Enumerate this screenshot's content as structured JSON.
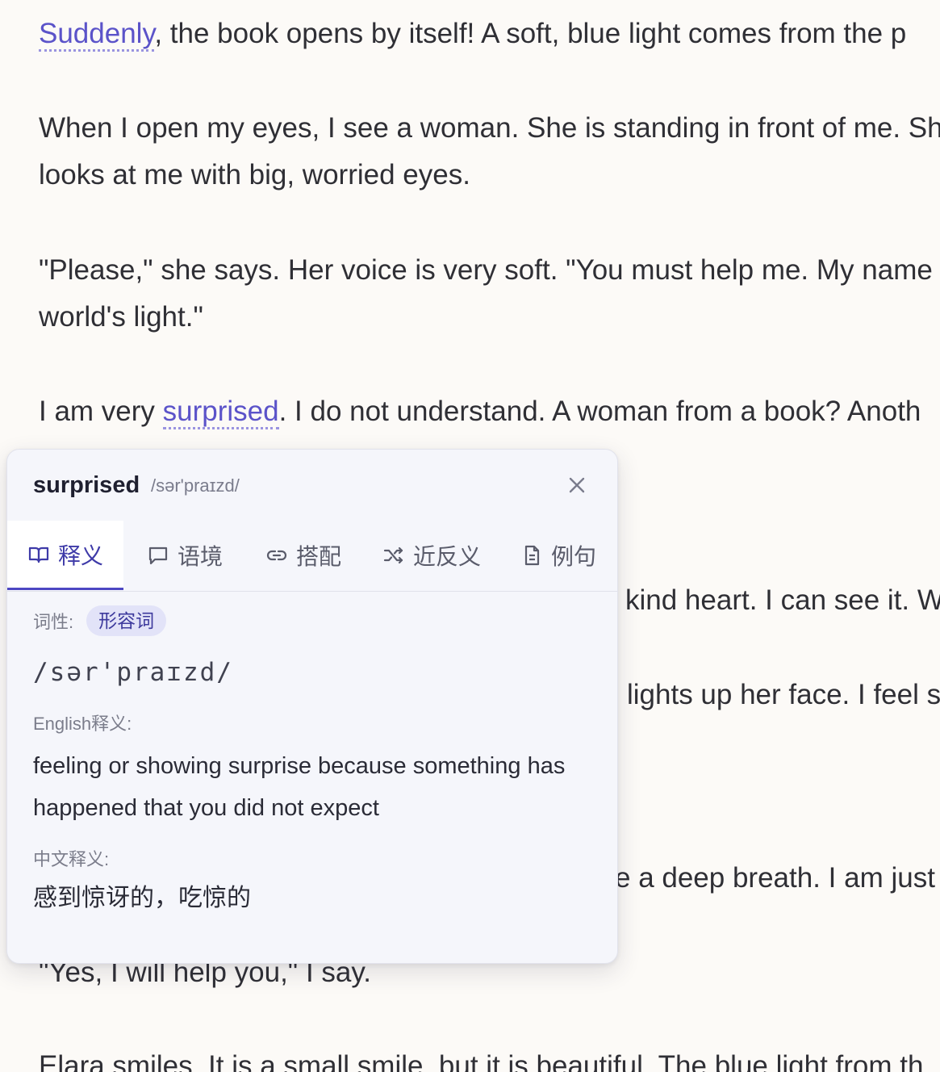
{
  "reader": {
    "p1": {
      "link": "Suddenly",
      "rest": ", the book opens by itself! A soft, blue light comes from the p"
    },
    "p2_line1": "When I open my eyes, I see a woman. She is standing in front of me. Sh",
    "p2_line2": "looks at me with big, worried eyes.",
    "p3_line1": "\"Please,\" she says. Her voice is very soft. \"You must help me. My name",
    "p3_line2": "world's light.\"",
    "p4": {
      "pre": "I am very ",
      "link": "surprised",
      "rest": ". I do not understand. A woman from a book? Anoth"
    },
    "frag1": "kind heart. I can see it. W",
    "frag2": "lights up her face. I feel s",
    "frag3": "e a deep breath. I am just",
    "p_yes": "\"Yes, I will help you,\" I say.",
    "p_last": "Elara smiles. It is a small smile, but it is beautiful. The blue light from th"
  },
  "popup": {
    "word": "surprised",
    "phonetic": "/sər'praɪzd/",
    "tabs": [
      {
        "label": "释义",
        "icon": "book-open-icon",
        "active": true
      },
      {
        "label": "语境",
        "icon": "chat-bubble-icon",
        "active": false
      },
      {
        "label": "搭配",
        "icon": "link-icon",
        "active": false
      },
      {
        "label": "近反义",
        "icon": "shuffle-icon",
        "active": false
      },
      {
        "label": "例句",
        "icon": "document-icon",
        "active": false
      }
    ],
    "pos_label": "词性:",
    "pos_value": "形容词",
    "ipa": "/sər'praɪzd/",
    "english_label": "English释义:",
    "english_def": "feeling or showing surprise because something has happened that you did not expect",
    "chinese_label": "中文释义:",
    "chinese_def": "感到惊讶的，吃惊的"
  },
  "colors": {
    "accent": "#4d47c2",
    "highlight_word": "#5b53c9",
    "background": "#fcfaf7",
    "popup_bg": "#f5f6fb"
  }
}
